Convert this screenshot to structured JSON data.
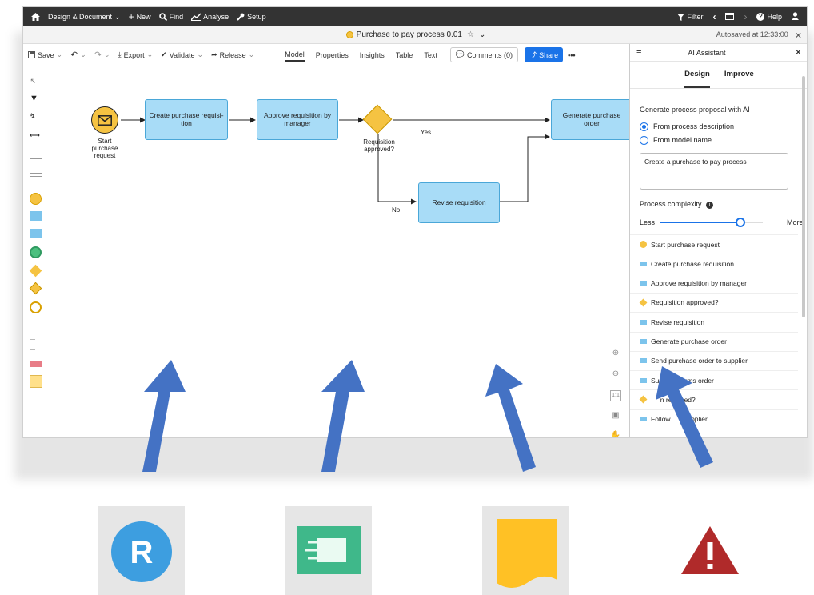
{
  "topbar": {
    "home_icon": "home-icon",
    "menu_design": "Design & Document",
    "new": "New",
    "find": "Find",
    "analyse": "Analyse",
    "setup": "Setup",
    "filter": "Filter",
    "help": "Help"
  },
  "titlebar": {
    "title": "Purchase to pay process 0.01",
    "autosave": "Autosaved at 12:33:00"
  },
  "toolbar": {
    "save": "Save",
    "export": "Export",
    "validate": "Validate",
    "release": "Release",
    "tabs": [
      "Model",
      "Properties",
      "Insights",
      "Table",
      "Text"
    ],
    "active_tab": "Model",
    "comments": "Comments (0)",
    "share": "Share"
  },
  "diagram": {
    "start_event": "Start purchase request",
    "task1": "Create purchase requisi- tion",
    "task2": "Approve requisition by manager",
    "gateway": "Requisition approved?",
    "task3": "Generate purchase order",
    "task4": "Revise requisition",
    "yes": "Yes",
    "no": "No"
  },
  "ai_panel": {
    "title": "AI Assistant",
    "tabs": [
      "Design",
      "Improve"
    ],
    "active_tab": "Design",
    "heading": "Generate process proposal with AI",
    "option1": "From process description",
    "option2": "From model name",
    "selected_option": "From process description",
    "prompt": "Create a purchase to pay process",
    "complexity_label": "Process complexity",
    "less": "Less",
    "more": "More",
    "complexity_level": 0.78,
    "items": [
      {
        "type": "event",
        "label": "Start purchase request"
      },
      {
        "type": "task",
        "label": "Create purchase requisition"
      },
      {
        "type": "task",
        "label": "Approve requisition by manager"
      },
      {
        "type": "gateway",
        "label": "Requisition approved?"
      },
      {
        "type": "task",
        "label": "Revise requisition"
      },
      {
        "type": "task",
        "label": "Generate purchase order"
      },
      {
        "type": "task",
        "label": "Send purchase order to supplier"
      },
      {
        "type": "task",
        "label": "Sup    confirms order"
      },
      {
        "type": "gateway",
        "label": "     n received?"
      },
      {
        "type": "task",
        "label": "Follow       supplier"
      },
      {
        "type": "task",
        "label": "Receive"
      }
    ]
  },
  "bottom_icons": {
    "r_letter": "R",
    "icon1": "r-badge-icon",
    "icon2": "green-notepad-icon",
    "icon3": "yellow-document-icon",
    "icon4": "warning-triangle-icon"
  },
  "colors": {
    "topbar": "#333333",
    "task_fill": "#a8dcf7",
    "accent": "#1a73e8",
    "gateway": "#f5c342",
    "arrow": "#4472c4",
    "warning": "#b02a2a"
  }
}
